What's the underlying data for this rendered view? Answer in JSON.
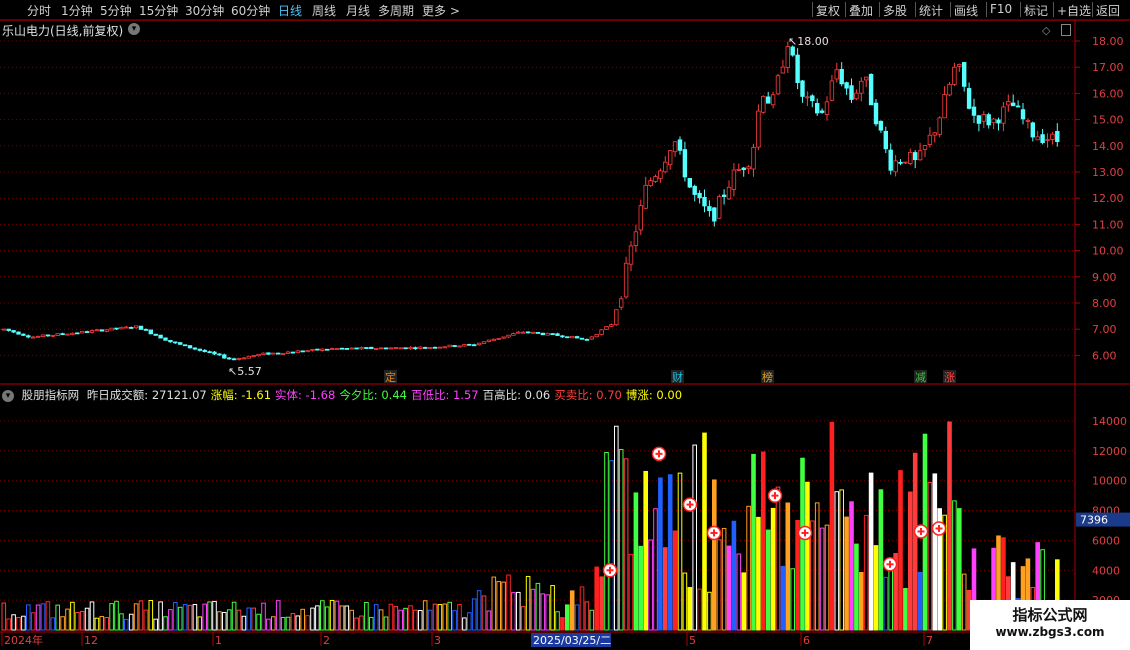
{
  "toolbar": {
    "periods": [
      {
        "label": "分时",
        "active": false
      },
      {
        "label": "1分钟",
        "active": false
      },
      {
        "label": "5分钟",
        "active": false
      },
      {
        "label": "15分钟",
        "active": false
      },
      {
        "label": "30分钟",
        "active": false
      },
      {
        "label": "60分钟",
        "active": false
      },
      {
        "label": "日线",
        "active": true
      },
      {
        "label": "周线",
        "active": false
      },
      {
        "label": "月线",
        "active": false
      },
      {
        "label": "多周期",
        "active": false
      },
      {
        "label": "更多 >",
        "active": false
      }
    ],
    "right_buttons": [
      "复权",
      "叠加",
      "多股",
      "统计",
      "画线",
      "F10",
      "标记",
      "+自选",
      "返回"
    ]
  },
  "main_chart": {
    "title": "乐山电力(日线,前复权)",
    "price_axis": [
      "18.00",
      "17.00",
      "16.00",
      "15.00",
      "14.00",
      "13.00",
      "12.00",
      "11.00",
      "10.00",
      "9.00",
      "8.00",
      "7.00",
      "6.00"
    ],
    "high_label": "18.00",
    "low_label": "5.57",
    "event_tags": [
      {
        "text": "定",
        "color": "#e08020"
      },
      {
        "text": "财",
        "color": "#20c0e0"
      },
      {
        "text": "榜",
        "color": "#e0a020"
      },
      {
        "text": "减",
        "color": "#40c040"
      },
      {
        "text": "涨",
        "color": "#ff4040"
      }
    ]
  },
  "indicator": {
    "name": "股朋指标网",
    "values": [
      {
        "label": "昨日成交额:",
        "value": "27121.07",
        "color": "#e0e0e0"
      },
      {
        "label": "涨幅:",
        "value": "-1.61",
        "color": "#ffff00"
      },
      {
        "label": "实体:",
        "value": "-1.68",
        "color": "#ff40ff"
      },
      {
        "label": "今夕比:",
        "value": "0.44",
        "color": "#40ff40"
      },
      {
        "label": "百低比:",
        "value": "1.57",
        "color": "#ff40ff"
      },
      {
        "label": "百高比:",
        "value": "0.06",
        "color": "#e0e0e0"
      },
      {
        "label": "买卖比:",
        "value": "0.70",
        "color": "#ff4040"
      },
      {
        "label": "博涨:",
        "value": "0.00",
        "color": "#ffff00"
      }
    ],
    "axis": [
      "14000",
      "12000",
      "10000",
      "8000",
      "6000",
      "4000",
      "2000"
    ],
    "current_value": "7396"
  },
  "time_axis": [
    "2024年",
    "12",
    "1",
    "2",
    "3",
    "2025/03/25/二",
    "5",
    "6",
    "7"
  ],
  "colors": {
    "up": "#ff3c3c",
    "down": "#54ffff",
    "grid": "#7a0000",
    "axis": "#b00000"
  },
  "watermark": {
    "line1": "指标公式网",
    "line2": "www.zbgs3.com"
  }
}
